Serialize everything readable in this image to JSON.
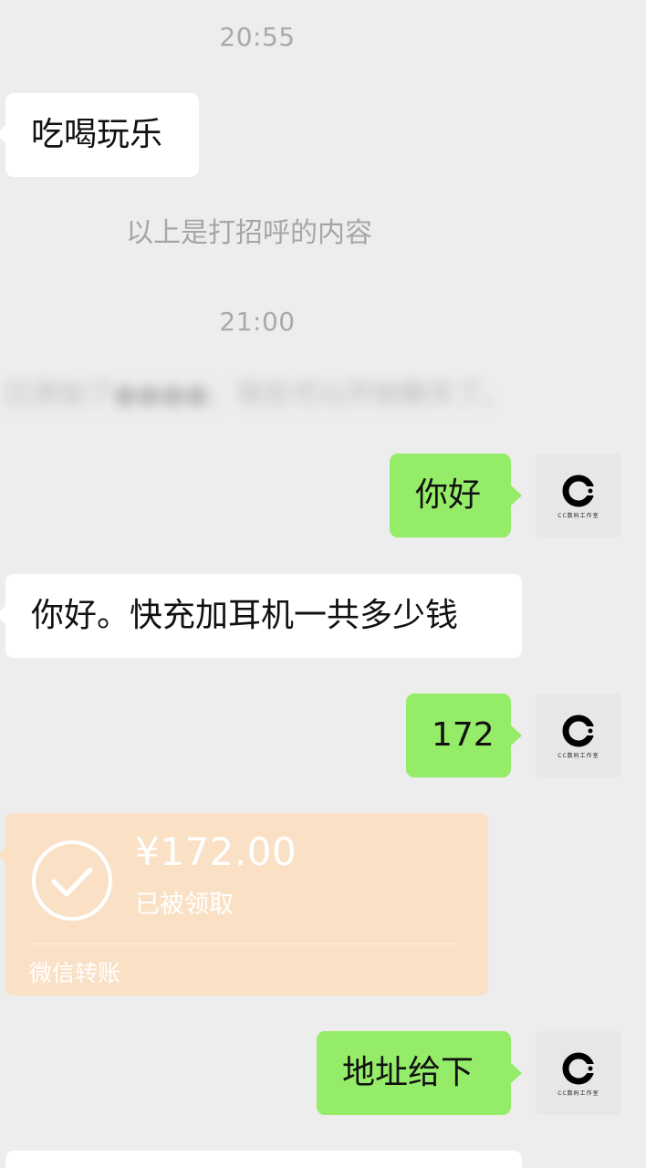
{
  "timestamps": [
    "20:55",
    "21:00"
  ],
  "system_note": "以上是打招呼的内容",
  "blurred_note": "已添加了●●●●，现在可以开始聊天了。",
  "messages": [
    {
      "side": "in",
      "text": "吃喝玩乐"
    },
    {
      "side": "out",
      "text": "你好"
    },
    {
      "side": "in",
      "text": "你好。快充加耳机一共多少钱"
    },
    {
      "side": "out",
      "text": "172"
    },
    {
      "side": "out",
      "text": "地址给下"
    }
  ],
  "transfer": {
    "amount": "¥172.00",
    "status": "已被领取",
    "label": "微信转账"
  },
  "avatar": {
    "caption": "CC数码工作室",
    "icon": "c-logo-icon"
  },
  "colors": {
    "background": "#ededed",
    "incoming_bubble": "#ffffff",
    "outgoing_bubble": "#95ec69",
    "transfer_card": "#fae1c6"
  }
}
